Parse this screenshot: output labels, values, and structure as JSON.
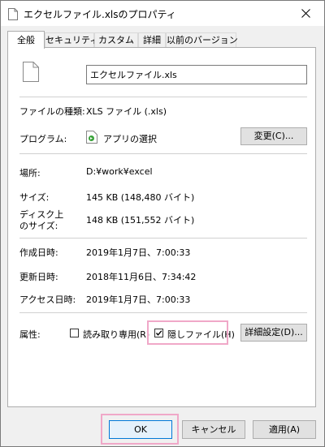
{
  "window": {
    "title": "エクセルファイル.xlsのプロパティ"
  },
  "tabs": [
    {
      "label": "全般",
      "active": true
    },
    {
      "label": "セキュリティ",
      "active": false
    },
    {
      "label": "カスタム",
      "active": false
    },
    {
      "label": "詳細",
      "active": false
    },
    {
      "label": "以前のバージョン",
      "active": false
    }
  ],
  "general": {
    "file_name": "エクセルファイル.xls",
    "file_type": {
      "label": "ファイルの種類:",
      "value": "XLS ファイル (.xls)"
    },
    "program": {
      "label": "プログラム:",
      "value": "アプリの選択",
      "change_button": "変更(C)..."
    },
    "location": {
      "label": "場所:",
      "value": "D:¥work¥excel"
    },
    "size": {
      "label": "サイズ:",
      "value": "145 KB (148,480 バイト)"
    },
    "disk_size": {
      "label_line1": "ディスク上",
      "label_line2": "のサイズ:",
      "value": "148 KB (151,552 バイト)"
    },
    "created": {
      "label": "作成日時:",
      "value": "2019年1月7日、7:00:33"
    },
    "modified": {
      "label": "更新日時:",
      "value": "2018年11月6日、7:34:42"
    },
    "accessed": {
      "label": "アクセス日時:",
      "value": "2019年1月7日、7:00:33"
    },
    "attributes": {
      "label": "属性:",
      "readonly": {
        "label": "読み取り専用(R)",
        "checked": false
      },
      "hidden": {
        "label": "隠しファイル(H)",
        "checked": true
      },
      "advanced_button": "詳細設定(D)..."
    }
  },
  "footer": {
    "ok": "OK",
    "cancel": "キャンセル",
    "apply": "適用(A)"
  },
  "colors": {
    "highlight": "#f0a8c8",
    "focus": "#0078d7"
  }
}
